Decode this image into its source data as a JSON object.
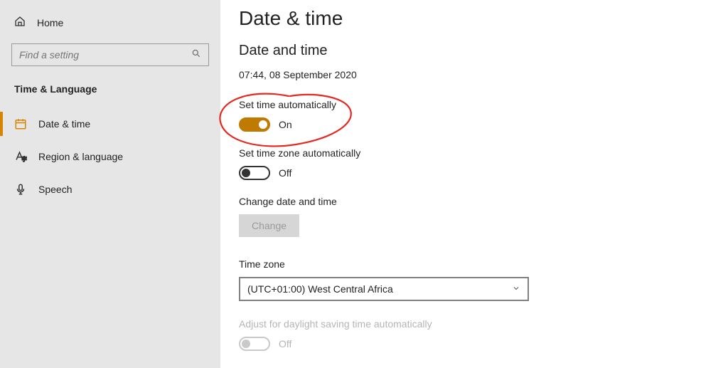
{
  "sidebar": {
    "home_label": "Home",
    "search_placeholder": "Find a setting",
    "category_label": "Time & Language",
    "items": [
      {
        "label": "Date & time"
      },
      {
        "label": "Region & language"
      },
      {
        "label": "Speech"
      }
    ]
  },
  "main": {
    "page_title": "Date & time",
    "section_title": "Date and time",
    "datetime_now": "07:44, 08 September 2020",
    "auto_time_label": "Set time automatically",
    "auto_time_state": "On",
    "auto_tz_label": "Set time zone automatically",
    "auto_tz_state": "Off",
    "change_label": "Change date and time",
    "change_button": "Change",
    "tz_label": "Time zone",
    "tz_value": "(UTC+01:00) West Central Africa",
    "dst_label": "Adjust for daylight saving time automatically",
    "dst_state": "Off"
  },
  "colors": {
    "accent": "#c17a00",
    "annotation": "#e52920"
  }
}
